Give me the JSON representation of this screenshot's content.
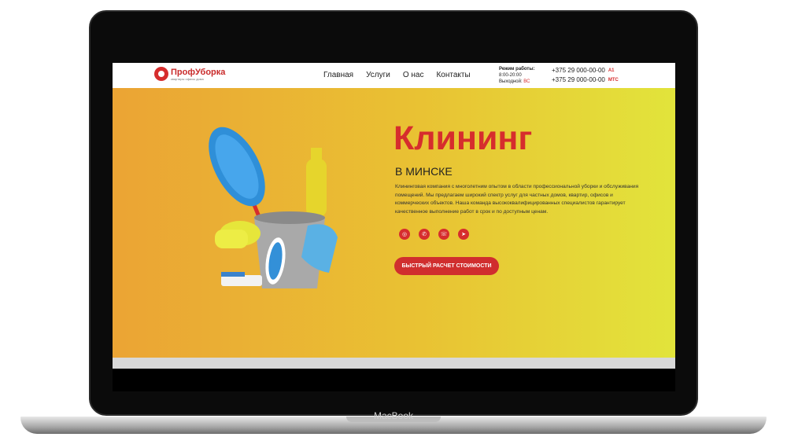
{
  "device": {
    "label": "MacBook"
  },
  "header": {
    "logo_name": "ПрофУборка",
    "logo_sub": "квартиры офисы дома",
    "nav": [
      "Главная",
      "Услуги",
      "О нас",
      "Контакты"
    ],
    "hours_title": "Режим работы:",
    "hours_time": "8:00-20:00",
    "weekend_label": "Выходной:",
    "weekend_day": "ВС",
    "phones": [
      {
        "number": "+375 29 000-00-00",
        "operator": "A1"
      },
      {
        "number": "+375 29 000-00-00",
        "operator": "МТС"
      }
    ]
  },
  "hero": {
    "title": "Клининг",
    "subtitle": "В МИНСКЕ",
    "description": "Клининговая компания с многолетним опытом в области профессиональной уборки и обслуживания помещений. Мы предлагаем широкий спектр услуг для частных домов, квартир, офисов и коммерческих объектов. Наша команда высококвалифицированных специалистов гарантирует качественное выполнение работ в срок и по доступным ценам.",
    "social_icons": [
      "instagram-icon",
      "viber-icon",
      "whatsapp-icon",
      "telegram-icon"
    ],
    "cta_label": "БЫСТРЫЙ РАСЧЕТ СТОИМОСТИ"
  },
  "colors": {
    "accent": "#d62d2d",
    "hero_left": "#eba434",
    "hero_right": "#e2e43b"
  }
}
